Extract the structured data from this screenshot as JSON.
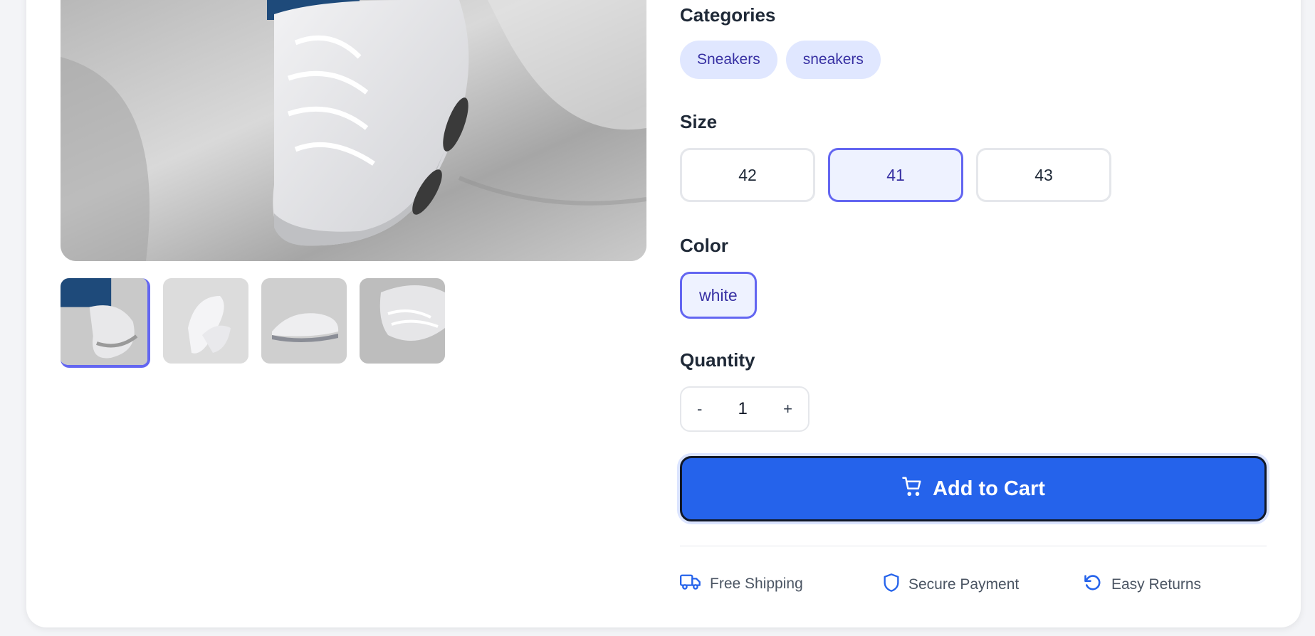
{
  "product": {
    "categories_label": "Categories",
    "categories": [
      "Sneakers",
      "sneakers"
    ],
    "size_label": "Size",
    "sizes": [
      "42",
      "41",
      "43"
    ],
    "selected_size": "41",
    "color_label": "Color",
    "color": "white",
    "quantity_label": "Quantity",
    "quantity": "1",
    "decrement": "-",
    "increment": "+",
    "add_to_cart": "Add to Cart"
  },
  "features": {
    "shipping": "Free Shipping",
    "payment": "Secure Payment",
    "returns": "Easy Returns"
  },
  "icons": {
    "cart": "cart-icon",
    "shipping": "truck-icon",
    "payment": "shield-icon",
    "returns": "rotate-ccw-icon"
  },
  "colors": {
    "accent": "#6366f1",
    "primary_button": "#2563eb",
    "chip_bg": "#e0e7ff",
    "chip_text": "#3730a3"
  }
}
